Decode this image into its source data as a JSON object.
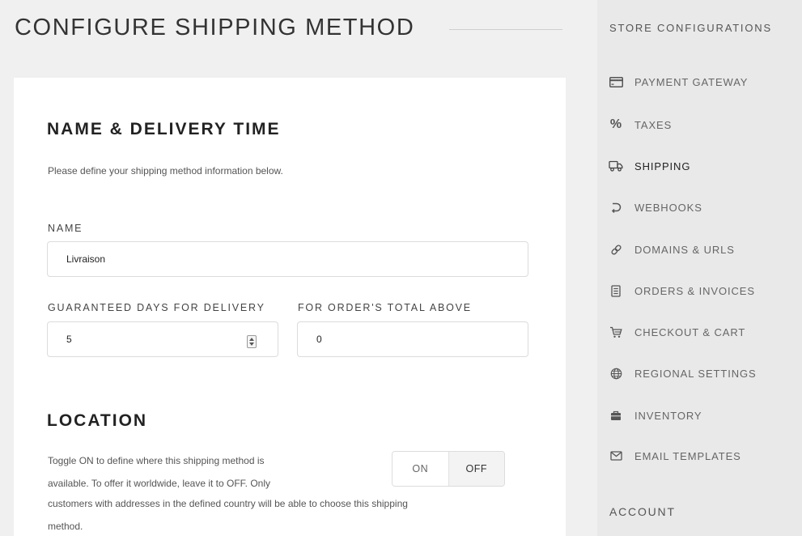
{
  "page": {
    "title": "CONFIGURE SHIPPING METHOD"
  },
  "name_delivery": {
    "heading": "NAME & DELIVERY TIME",
    "description": "Please define your shipping method information below.",
    "name_label": "NAME",
    "name_value": "Livraison",
    "days_label": "GUARANTEED DAYS FOR DELIVERY",
    "days_value": "5",
    "total_label": "FOR ORDER'S TOTAL ABOVE",
    "total_value": "0"
  },
  "location": {
    "heading": "LOCATION",
    "text_line1": "Toggle ON to define where this shipping method is",
    "text_line2": "available. To offer it worldwide, leave it to OFF. Only",
    "text_line3": "customers with addresses in the defined country will be able to choose this shipping",
    "text_line4": "method.",
    "toggle_on": "ON",
    "toggle_off": "OFF",
    "toggle_state": "OFF"
  },
  "sidebar": {
    "section_title": "STORE CONFIGURATIONS",
    "items": [
      {
        "label": "PAYMENT GATEWAY",
        "icon": "credit-card-icon"
      },
      {
        "label": "TAXES",
        "icon": "percent-icon"
      },
      {
        "label": "SHIPPING",
        "icon": "truck-icon",
        "active": true
      },
      {
        "label": "WEBHOOKS",
        "icon": "hook-icon"
      },
      {
        "label": "DOMAINS & URLS",
        "icon": "link-icon"
      },
      {
        "label": "ORDERS & INVOICES",
        "icon": "receipt-icon"
      },
      {
        "label": "CHECKOUT & CART",
        "icon": "cart-icon"
      },
      {
        "label": "REGIONAL SETTINGS",
        "icon": "globe-icon"
      },
      {
        "label": "INVENTORY",
        "icon": "box-icon"
      },
      {
        "label": "EMAIL TEMPLATES",
        "icon": "envelope-icon"
      }
    ],
    "account_title": "ACCOUNT"
  },
  "colors": {
    "background": "#f0f0f0",
    "card": "#ffffff",
    "sidebar": "#e9e9e9"
  }
}
